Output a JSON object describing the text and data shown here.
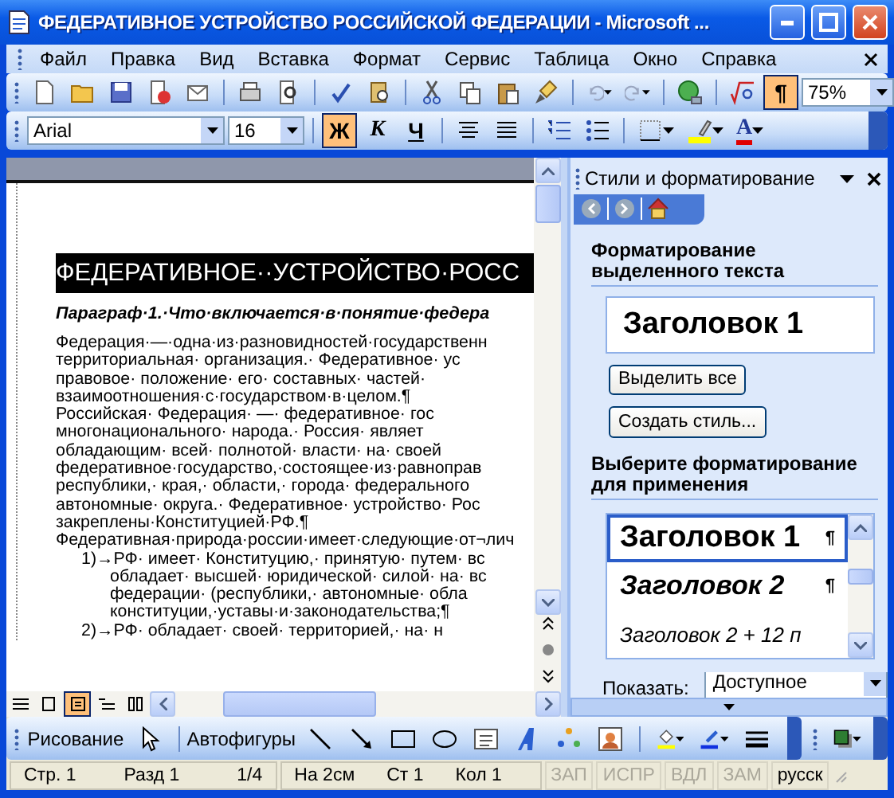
{
  "window": {
    "title": "ФЕДЕРАТИВНОЕ  УСТРОЙСТВО РОССИЙСКОЙ  ФЕДЕРАЦИИ - Microsoft ..."
  },
  "menu": [
    "Файл",
    "Правка",
    "Вид",
    "Вставка",
    "Формат",
    "Сервис",
    "Таблица",
    "Окно",
    "Справка"
  ],
  "standard_toolbar": {
    "show_marks": {
      "label": "¶",
      "on": true
    },
    "zoom": "75%"
  },
  "formatting_toolbar": {
    "font": "Arial",
    "size": "16",
    "bold": {
      "label": "Ж",
      "on": true
    },
    "italic": {
      "label": "К",
      "on": false
    },
    "underline": {
      "label": "Ч",
      "on": false
    },
    "font_color": {
      "label": "A"
    }
  },
  "document": {
    "lines": [
      {
        "kind": "heading",
        "text": "ФЕДЕРАТИВНОЕ··УСТРОЙСТВО·РОСС"
      },
      {
        "kind": "subheading",
        "text": "Параграф·1.·Что·включается·в·понятие·федера"
      },
      {
        "kind": "body",
        "text": "Федерация·—·одна·из·разновидностей·государственн"
      },
      {
        "kind": "body",
        "text": "территориальная· организация.· Федеративное· ус"
      },
      {
        "kind": "body",
        "text": "правовое· положение· его· составных· частей·"
      },
      {
        "kind": "body",
        "text": "взаимоотношения·с·государством·в·целом.¶"
      },
      {
        "kind": "body",
        "text": "Российская· Федерация· —· федеративное· гос"
      },
      {
        "kind": "body",
        "text": "многонационального· народа.· Россия· являет"
      },
      {
        "kind": "body",
        "text": "обладающим· всей· полнотой· власти· на· своей"
      },
      {
        "kind": "body",
        "text": "федеративное·государство,·состоящее·из·равноправ"
      },
      {
        "kind": "body",
        "text": "республики,· края,· области,· города· федерального"
      },
      {
        "kind": "body",
        "text": "автономные· округа.· Федеративное· устройство· Рос"
      },
      {
        "kind": "body",
        "text": "закреплены·Конституцией·РФ.¶"
      },
      {
        "kind": "body",
        "text": "Федеративная·природа·россии·имеет·следующие·от¬лич"
      },
      {
        "kind": "item",
        "text": "1)→РФ· имеет· Конституцию,· принятую· путем· вс"
      },
      {
        "kind": "cont",
        "text": "обладает· высшей· юридической· силой· на· вс"
      },
      {
        "kind": "cont",
        "text": "федерации· (республики,· автономные· обла"
      },
      {
        "kind": "cont",
        "text": "конституции,·уставы·и·законодательства;¶"
      },
      {
        "kind": "item",
        "text": "2)→РФ· обладает· своей· территорией,· на· н"
      }
    ]
  },
  "view_buttons": [
    {
      "selected": false
    },
    {
      "selected": false
    },
    {
      "selected": true
    },
    {
      "selected": false
    },
    {
      "selected": false
    }
  ],
  "task_pane": {
    "title": "Стили и форматирование",
    "selection_heading": "Форматирование выделенного текста",
    "current_style": "Заголовок 1",
    "buttons": [
      "Выделить все",
      "Создать стиль..."
    ],
    "apply_heading": "Выберите форматирование для применения",
    "styles": [
      {
        "kind": "h1",
        "label": "Заголовок 1",
        "mark": "¶",
        "selected": true
      },
      {
        "kind": "h2",
        "label": "Заголовок 2",
        "mark": "¶",
        "selected": false
      },
      {
        "kind": "h2small",
        "label": "Заголовок 2 + 12 п",
        "selected": false
      }
    ],
    "show_label": "Показать:",
    "show_value": "Доступное"
  },
  "drawing_toolbar": {
    "draw_menu": "Рисование",
    "autoshapes_menu": "Автофигуры"
  },
  "status_bar": {
    "fields": [
      "Стр. 1",
      "Разд 1",
      "1/4",
      "На 2см",
      "Ст 1",
      "Кол 1"
    ],
    "modes": [
      {
        "label": "ЗАП",
        "on": false
      },
      {
        "label": "ИСПР",
        "on": false
      },
      {
        "label": "ВДЛ",
        "on": false
      },
      {
        "label": "ЗАМ",
        "on": false
      }
    ],
    "language": "русск"
  }
}
